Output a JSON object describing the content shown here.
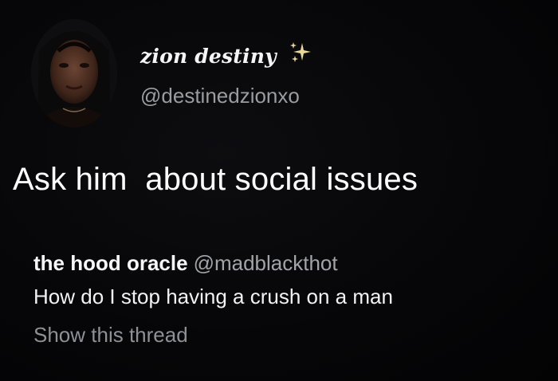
{
  "tweet": {
    "display_name": "zion destiny",
    "name_icon": "sparkles-icon",
    "handle": "@destinedzionxo",
    "text": "Ask him  about social issues",
    "avatar_icon": "profile-photo"
  },
  "quoted_tweet": {
    "display_name": "the hood oracle",
    "handle": "@madblackthot",
    "text": "How do I stop having a crush on a man",
    "show_thread_label": "Show this thread"
  },
  "colors": {
    "background": "#050507",
    "primary_text": "#ffffff",
    "secondary_text": "#9a9ca2",
    "sparkle": "#e8d79a"
  }
}
